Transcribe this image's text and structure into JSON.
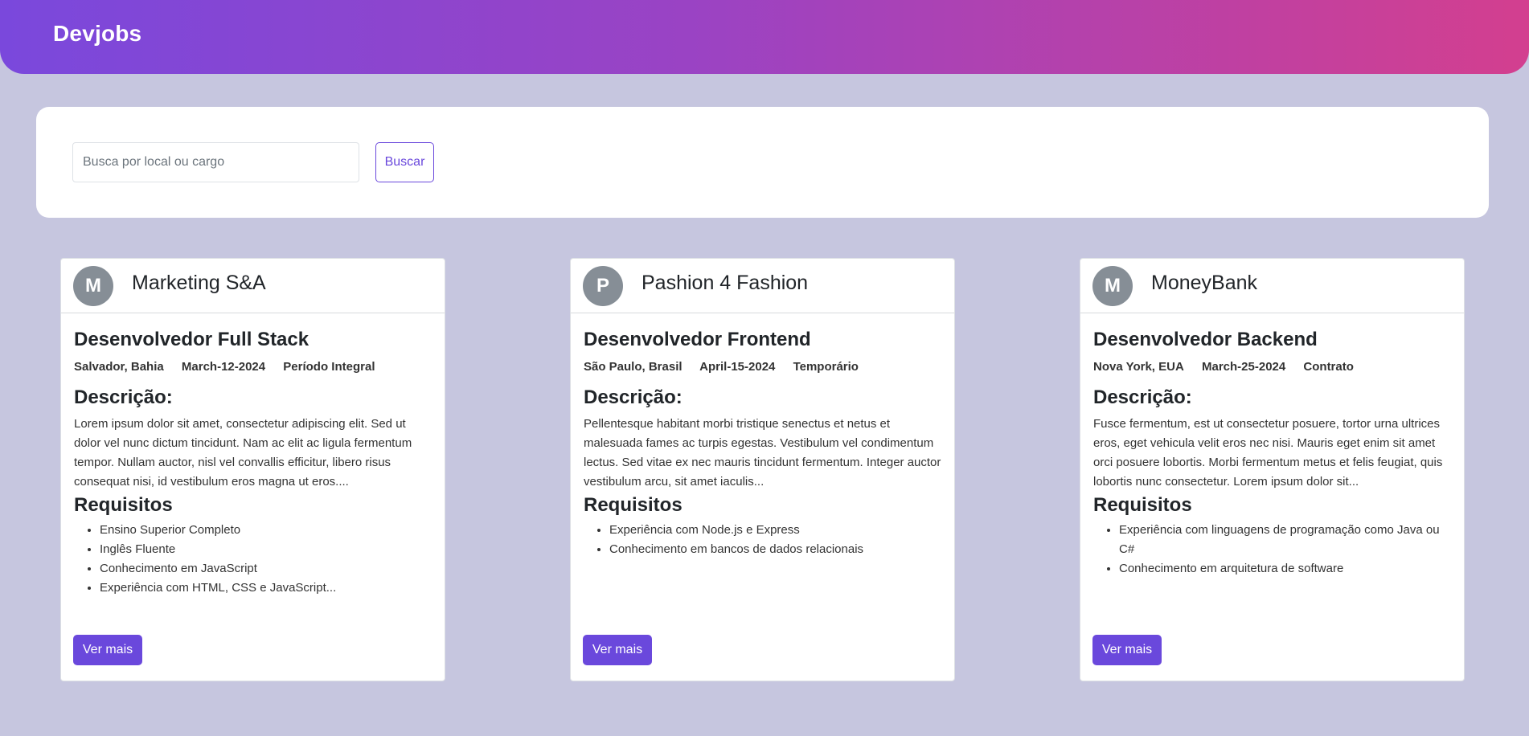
{
  "header": {
    "brand": "Devjobs"
  },
  "search": {
    "placeholder": "Busca por local ou cargo",
    "value": "",
    "button_label": "Buscar"
  },
  "colors": {
    "background": "#c6c6df",
    "gradient_start": "#7a48dc",
    "gradient_end": "#d33f8f",
    "accent": "#6a48dc",
    "avatar": "#868e96"
  },
  "jobs": [
    {
      "avatar_letter": "M",
      "company": "Marketing S&A",
      "title": "Desenvolvedor Full Stack",
      "location": "Salvador, Bahia",
      "date": "March-12-2024",
      "type": "Período Integral",
      "description_heading": "Descrição:",
      "description": "Lorem ipsum dolor sit amet, consectetur adipiscing elit. Sed ut dolor vel nunc dictum tincidunt. Nam ac elit ac ligula fermentum tempor. Nullam auctor, nisl vel convallis efficitur, libero risus consequat nisi, id vestibulum eros magna ut eros....",
      "requirements_heading": "Requisitos",
      "requirements": [
        "Ensino Superior Completo",
        "Inglês Fluente",
        "Conhecimento em JavaScript",
        "Experiência com HTML, CSS e JavaScript..."
      ],
      "button_label": "Ver mais"
    },
    {
      "avatar_letter": "P",
      "company": "Pashion 4 Fashion",
      "title": "Desenvolvedor Frontend",
      "location": "São Paulo, Brasil",
      "date": "April-15-2024",
      "type": "Temporário",
      "description_heading": "Descrição:",
      "description": "Pellentesque habitant morbi tristique senectus et netus et malesuada fames ac turpis egestas. Vestibulum vel condimentum lectus. Sed vitae ex nec mauris tincidunt fermentum. Integer auctor vestibulum arcu, sit amet iaculis...",
      "requirements_heading": "Requisitos",
      "requirements": [
        "Experiência com Node.js e Express",
        "Conhecimento em bancos de dados relacionais"
      ],
      "button_label": "Ver mais"
    },
    {
      "avatar_letter": "M",
      "company": "MoneyBank",
      "title": "Desenvolvedor Backend",
      "location": "Nova York, EUA",
      "date": "March-25-2024",
      "type": "Contrato",
      "description_heading": "Descrição:",
      "description": "Fusce fermentum, est ut consectetur posuere, tortor urna ultrices eros, eget vehicula velit eros nec nisi. Mauris eget enim sit amet orci posuere lobortis. Morbi fermentum metus et felis feugiat, quis lobortis nunc consectetur. Lorem ipsum dolor sit...",
      "requirements_heading": "Requisitos",
      "requirements": [
        "Experiência com linguagens de programação como Java ou C#",
        "Conhecimento em arquitetura de software"
      ],
      "button_label": "Ver mais"
    }
  ]
}
